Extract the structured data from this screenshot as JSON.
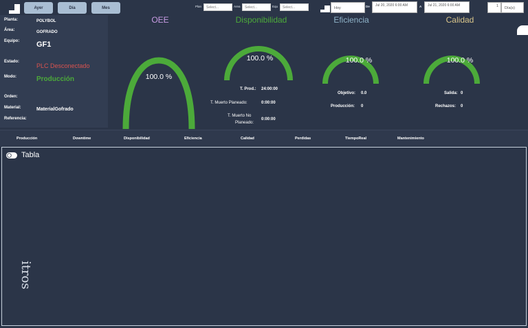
{
  "period_buttons": [
    "Ayer",
    "Día",
    "Mes"
  ],
  "filters": {
    "planta": {
      "label": "Plan",
      "placeholder": "Select..."
    },
    "area": {
      "label": "Area",
      "placeholder": "Select..."
    },
    "equipo": {
      "label": "Equ",
      "placeholder": "Select..."
    }
  },
  "range": {
    "preset": "Hoy",
    "de_label": "De",
    "from": "Jul 20, 2020 6:00 AM",
    "a_label": "A",
    "to": "Jul 21, 2020 6:00 AM",
    "count": "1",
    "unit": "Día(s)"
  },
  "info": {
    "planta_label": "Planta:",
    "planta": "POLYBOL",
    "area_label": "Área:",
    "area": "GOFRADO",
    "equipo_label": "Equipo:",
    "equipo": "GF1",
    "estado_label": "Estado:",
    "estado": "PLC Desconectado",
    "modo_label": "Modo:",
    "modo": "Producción",
    "orden_label": "Orden:",
    "orden": "",
    "material_label": "Material:",
    "material": "MaterialGofrado",
    "referencia_label": "Referencia:",
    "referencia": ""
  },
  "gauges": {
    "oee": {
      "title": "OEE",
      "value": "100.0 %",
      "color": "#c79be3"
    },
    "disponibilidad": {
      "title": "Disponibilidad",
      "value": "100.0 %",
      "color": "#4caa3a"
    },
    "eficiencia": {
      "title": "Eficiencia",
      "value": "100.0 %",
      "color": "#8fb3c9"
    },
    "calidad": {
      "title": "Calidad",
      "value": "100.0 %",
      "color": "#d8c48a"
    }
  },
  "disponibilidad_stats": {
    "t_prod_label": "T. Prod.:",
    "t_prod": "24:00:00",
    "t_mp_label": "T. Muerto Planeado:",
    "t_mp": "0:00:00",
    "t_mnp_label1": "T. Muerto No",
    "t_mnp_label2": "Planeado:",
    "t_mnp": "0:00:00"
  },
  "eficiencia_stats": {
    "objetivo_label": "Objetivo:",
    "objetivo": "0.0",
    "produccion_label": "Producción:",
    "produccion": "0"
  },
  "calidad_stats": {
    "salida_label": "Salida:",
    "salida": "0",
    "rechazos_label": "Rechazos:",
    "rechazos": "0"
  },
  "tabs": [
    "Producción",
    "Downtime",
    "Disponibilidad",
    "Eficiencia",
    "Calidad",
    "Perdidas",
    "TiempoReal",
    "Mantenimiento"
  ],
  "table": {
    "title": "Tabla",
    "rotated_text": "itros"
  },
  "colors": {
    "bg": "#2b3548",
    "gauge": "#4caa3a",
    "estado": "#d9534f",
    "modo": "#4caa3a"
  }
}
